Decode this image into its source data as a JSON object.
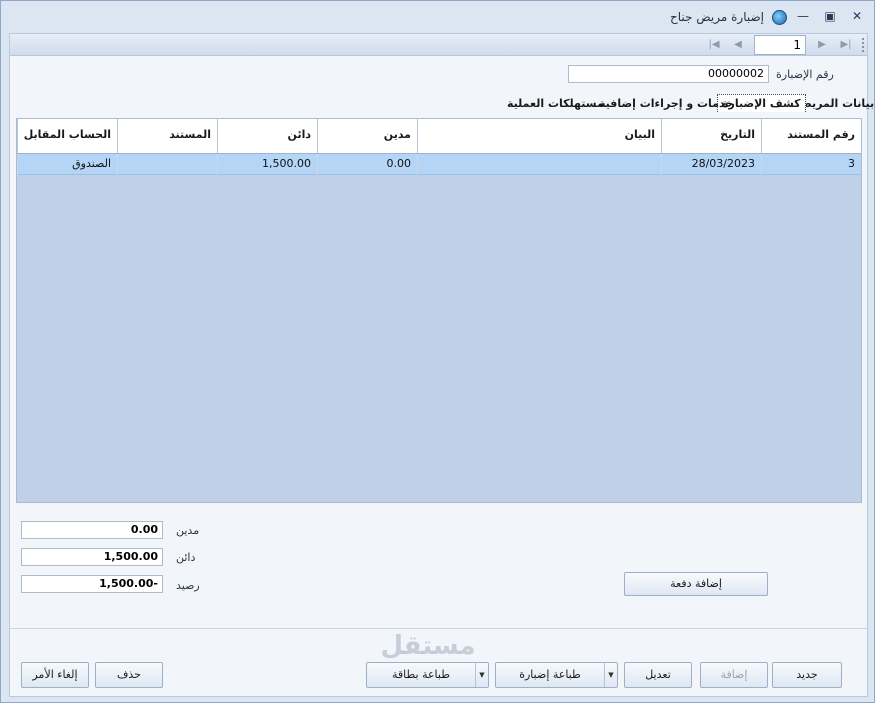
{
  "window": {
    "title": "إضبارة مريض جناح"
  },
  "navigator": {
    "record_number": "1"
  },
  "header": {
    "file_number_label": "رقم الإضبارة",
    "file_number_value": "00000002"
  },
  "tabs": [
    {
      "label": "بيانات المريض",
      "active": false
    },
    {
      "label": "كشف الإضبارة",
      "active": true
    },
    {
      "label": "خدمات و إجراءات إضافية",
      "active": false
    },
    {
      "label": "مستهلكات العملية",
      "active": false
    }
  ],
  "grid": {
    "columns": [
      "رقم المستند",
      "التاريخ",
      "البيان",
      "مدين",
      "دائن",
      "المستند",
      "الحساب المقابل"
    ],
    "rows": [
      {
        "doc_no": "3",
        "date": "28/03/2023",
        "statement": "",
        "debit": "0.00",
        "credit": "1,500.00",
        "document": "",
        "counter_account": "الصندوق"
      }
    ]
  },
  "summary": {
    "debit_label": "مدين",
    "debit_value": "0.00",
    "credit_label": "دائن",
    "credit_value": "1,500.00",
    "balance_label": "رصيد",
    "balance_value": "1,500.00-"
  },
  "buttons": {
    "add_payment": "إضافة دفعة",
    "new": "جديد",
    "add": "إضافة",
    "edit": "تعديل",
    "print_file": "طباعة إضبارة",
    "print_card": "طباعة بطاقة",
    "delete": "حذف",
    "cancel": "إلغاء الأمر"
  },
  "watermark": {
    "text": "مستقل"
  }
}
